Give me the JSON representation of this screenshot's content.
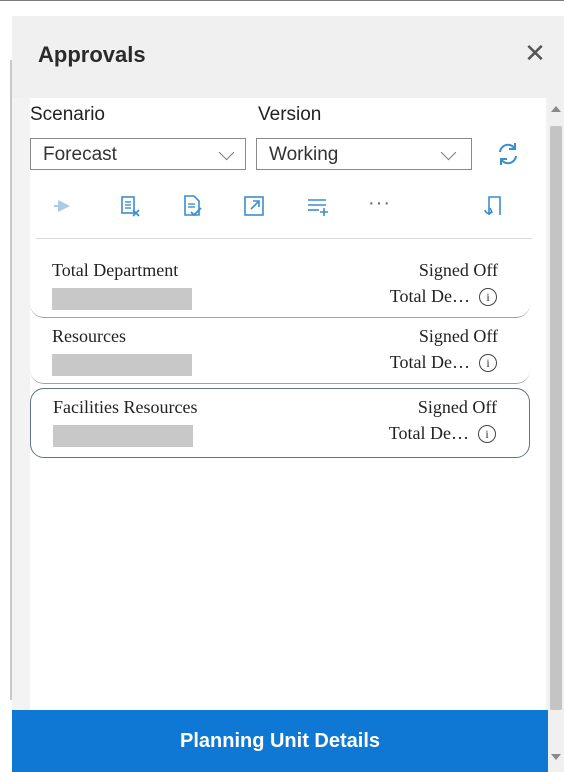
{
  "panel": {
    "title": "Approvals"
  },
  "filters": {
    "scenario_label": "Scenario",
    "scenario_value": "Forecast",
    "version_label": "Version",
    "version_value": "Working"
  },
  "toolbar": {
    "icons": [
      "play-icon",
      "reject-list-icon",
      "approve-document-icon",
      "open-external-icon",
      "add-list-icon",
      "more-icon",
      "export-icon"
    ],
    "more_label": "···"
  },
  "items": [
    {
      "name": "Total Department",
      "status": "Signed Off",
      "parent": "Total De…",
      "info": "i"
    },
    {
      "name": "Resources",
      "status": "Signed Off",
      "parent": "Total De…",
      "info": "i"
    },
    {
      "name": "Facilities Resources",
      "status": "Signed Off",
      "parent": "Total De…",
      "info": "i"
    }
  ],
  "footer": {
    "button_label": "Planning Unit Details"
  },
  "colors": {
    "accent": "#0f78d4",
    "toolbar_icon": "#3c8dcf"
  }
}
